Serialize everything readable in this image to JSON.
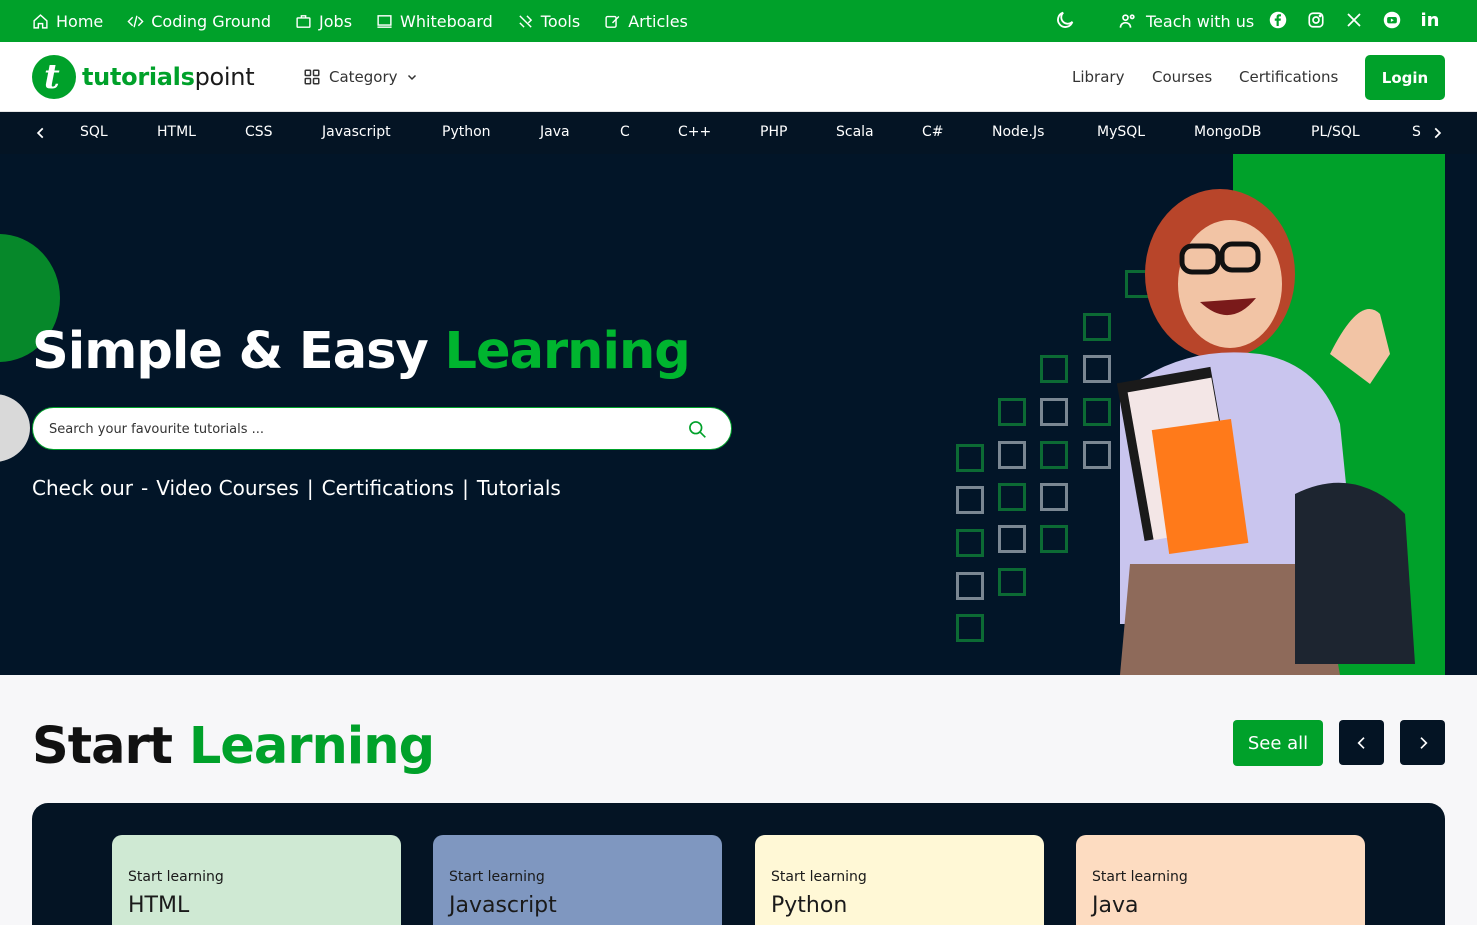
{
  "topbar": {
    "items": [
      {
        "label": "Home",
        "icon": "home-icon"
      },
      {
        "label": "Coding Ground",
        "icon": "code-icon"
      },
      {
        "label": "Jobs",
        "icon": "briefcase-icon"
      },
      {
        "label": "Whiteboard",
        "icon": "whiteboard-icon"
      },
      {
        "label": "Tools",
        "icon": "tools-icon"
      },
      {
        "label": "Articles",
        "icon": "edit-icon"
      }
    ],
    "teach_label": "Teach with us",
    "social": [
      "facebook-icon",
      "instagram-icon",
      "x-icon",
      "youtube-icon",
      "linkedin-icon"
    ]
  },
  "navbar": {
    "logo_main": "tutorials",
    "logo_point": "point",
    "logo_mark": "t",
    "category_label": "Category",
    "links": [
      "Library",
      "Courses",
      "Certifications"
    ],
    "login_label": "Login"
  },
  "langbar": {
    "items": [
      "SQL",
      "HTML",
      "CSS",
      "Javascript",
      "Python",
      "Java",
      "C",
      "C++",
      "PHP",
      "Scala",
      "C#",
      "Node.Js",
      "MySQL",
      "MongoDB",
      "PL/SQL",
      "S"
    ]
  },
  "hero": {
    "title_white": "Simple & Easy ",
    "title_green": "Learning",
    "search_placeholder": "Search your favourite tutorials ...",
    "check_prefix": "Check our",
    "check_dash": "-",
    "check_links": [
      "Video Courses",
      "Certifications",
      "Tutorials"
    ],
    "separator": "|"
  },
  "start_learning": {
    "title_black": "Start ",
    "title_green": "Learning",
    "see_all": "See all",
    "cards": [
      {
        "sub": "Start learning",
        "name": "HTML",
        "color": "#cfe9d3"
      },
      {
        "sub": "Start learning",
        "name": "Javascript",
        "color": "#7f97c0"
      },
      {
        "sub": "Start learning",
        "name": "Python",
        "color": "#fff8d6"
      },
      {
        "sub": "Start learning",
        "name": "Java",
        "color": "#fddcc1"
      }
    ]
  },
  "colors": {
    "brand_green": "#00a12a",
    "dark_navy": "#041424"
  }
}
